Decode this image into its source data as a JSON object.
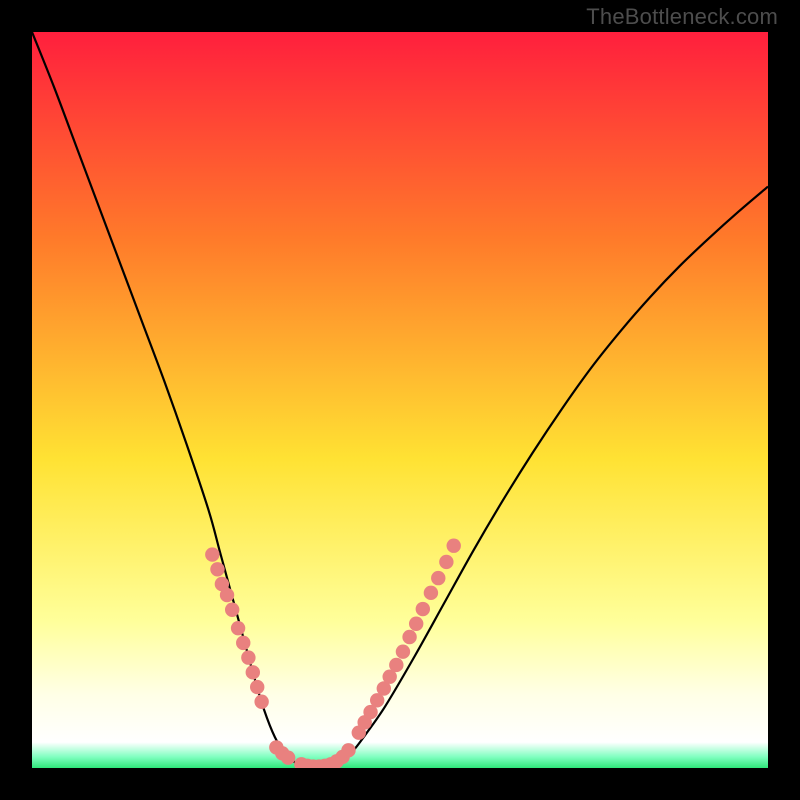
{
  "watermark": "TheBottleneck.com",
  "colors": {
    "bg_outer": "#000000",
    "gradient_top": "#ff1f3d",
    "gradient_upper_mid": "#ff7a2a",
    "gradient_mid": "#ffe233",
    "gradient_lower_light": "#ffff9a",
    "gradient_lower_pale": "#ffffe6",
    "gradient_bottom": "#2fe67a",
    "curve": "#000000",
    "dots": "#e9817f"
  },
  "chart_data": {
    "type": "line",
    "title": "",
    "xlabel": "",
    "ylabel": "",
    "xlim": [
      0,
      100
    ],
    "ylim": [
      0,
      100
    ],
    "series": [
      {
        "name": "bottleneck-curve",
        "x": [
          0,
          3,
          6,
          9,
          12,
          15,
          18,
          21,
          24,
          25.5,
          27,
          28.5,
          30,
          31.5,
          33,
          34.5,
          36,
          37.5,
          39.5,
          41.5,
          43.5,
          45.5,
          48,
          52,
          56,
          60,
          64,
          68,
          72,
          76,
          80,
          84,
          88,
          92,
          96,
          100
        ],
        "values": [
          100,
          92.5,
          84.5,
          76.5,
          68.5,
          60.5,
          52.5,
          44,
          35,
          29.5,
          24,
          18.5,
          13,
          8,
          4.2,
          1.8,
          0.6,
          0.0,
          0.0,
          0.7,
          2.2,
          4.8,
          8.4,
          15.2,
          22.4,
          29.6,
          36.4,
          42.8,
          48.8,
          54.4,
          59.4,
          64.0,
          68.2,
          72.0,
          75.6,
          79.0
        ]
      }
    ],
    "dot_clusters": [
      {
        "comment": "left descending dotted segment just above floor",
        "x": [
          24.5,
          25.2,
          25.8,
          26.5,
          27.2,
          28.0,
          28.7,
          29.4,
          30.0,
          30.6,
          31.2
        ],
        "y": [
          29.0,
          27.0,
          25.0,
          23.5,
          21.5,
          19.0,
          17.0,
          15.0,
          13.0,
          11.0,
          9.0
        ]
      },
      {
        "comment": "trough floor dots left-to-right",
        "x": [
          33.2,
          34.0,
          34.8,
          36.6,
          37.4,
          38.2,
          39.0,
          39.8,
          40.6,
          41.4,
          42.2,
          43.0
        ],
        "y": [
          2.8,
          2.0,
          1.4,
          0.5,
          0.3,
          0.2,
          0.2,
          0.3,
          0.5,
          0.9,
          1.5,
          2.4
        ]
      },
      {
        "comment": "right ascending dotted segment",
        "x": [
          44.4,
          45.2,
          46.0,
          46.9,
          47.8,
          48.6,
          49.5,
          50.4,
          51.3,
          52.2,
          53.1,
          54.2,
          55.2,
          56.3,
          57.3
        ],
        "y": [
          4.8,
          6.2,
          7.6,
          9.2,
          10.8,
          12.4,
          14.0,
          15.8,
          17.8,
          19.6,
          21.6,
          23.8,
          25.8,
          28.0,
          30.2
        ]
      }
    ],
    "background_gradient_stops": [
      {
        "offset": 0.0,
        "color": "#ff1f3d"
      },
      {
        "offset": 0.28,
        "color": "#ff7a2a"
      },
      {
        "offset": 0.58,
        "color": "#ffe233"
      },
      {
        "offset": 0.8,
        "color": "#ffff9a"
      },
      {
        "offset": 0.9,
        "color": "#ffffe6"
      },
      {
        "offset": 0.965,
        "color": "#ffffff"
      },
      {
        "offset": 0.985,
        "color": "#7fffc0"
      },
      {
        "offset": 1.0,
        "color": "#2fe67a"
      }
    ]
  }
}
